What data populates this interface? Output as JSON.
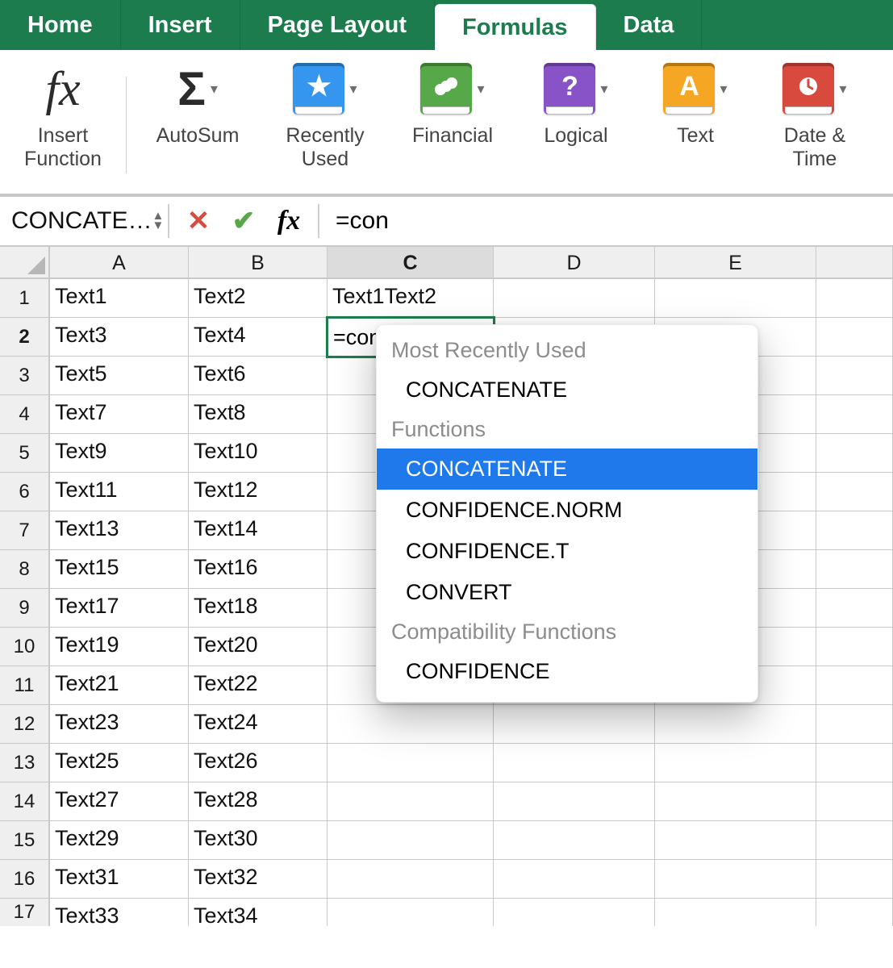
{
  "tabs": {
    "home": "Home",
    "insert": "Insert",
    "page_layout": "Page Layout",
    "formulas": "Formulas",
    "data": "Data"
  },
  "ribbon": {
    "insert_function": "Insert\nFunction",
    "autosum": "AutoSum",
    "recently_used": "Recently\nUsed",
    "financial": "Financial",
    "logical": "Logical",
    "text": "Text",
    "date_time": "Date &\nTime"
  },
  "namebox": "CONCATE…",
  "formula": "=con",
  "columns": [
    "A",
    "B",
    "C",
    "D",
    "E"
  ],
  "active": {
    "col": "C",
    "row": 2,
    "value": "=con"
  },
  "rows": [
    {
      "n": 1,
      "A": "Text1",
      "B": "Text2",
      "C": "Text1Text2"
    },
    {
      "n": 2,
      "A": "Text3",
      "B": "Text4",
      "C": "=con"
    },
    {
      "n": 3,
      "A": "Text5",
      "B": "Text6"
    },
    {
      "n": 4,
      "A": "Text7",
      "B": "Text8"
    },
    {
      "n": 5,
      "A": "Text9",
      "B": "Text10"
    },
    {
      "n": 6,
      "A": "Text11",
      "B": "Text12"
    },
    {
      "n": 7,
      "A": "Text13",
      "B": "Text14"
    },
    {
      "n": 8,
      "A": "Text15",
      "B": "Text16"
    },
    {
      "n": 9,
      "A": "Text17",
      "B": "Text18"
    },
    {
      "n": 10,
      "A": "Text19",
      "B": "Text20"
    },
    {
      "n": 11,
      "A": "Text21",
      "B": "Text22"
    },
    {
      "n": 12,
      "A": "Text23",
      "B": "Text24"
    },
    {
      "n": 13,
      "A": "Text25",
      "B": "Text26"
    },
    {
      "n": 14,
      "A": "Text27",
      "B": "Text28"
    },
    {
      "n": 15,
      "A": "Text29",
      "B": "Text30"
    },
    {
      "n": 16,
      "A": "Text31",
      "B": "Text32"
    },
    {
      "n": 17,
      "A": "Text33",
      "B": "Text34"
    }
  ],
  "autocomplete": {
    "groups": [
      {
        "header": "Most Recently Used",
        "items": [
          {
            "label": "CONCATENATE",
            "selected": false
          }
        ]
      },
      {
        "header": "Functions",
        "items": [
          {
            "label": "CONCATENATE",
            "selected": true
          },
          {
            "label": "CONFIDENCE.NORM",
            "selected": false
          },
          {
            "label": "CONFIDENCE.T",
            "selected": false
          },
          {
            "label": "CONVERT",
            "selected": false
          }
        ]
      },
      {
        "header": "Compatibility Functions",
        "items": [
          {
            "label": "CONFIDENCE",
            "selected": false
          }
        ]
      }
    ]
  },
  "colors": {
    "ribbon_green": "#1d7c4e",
    "star_blue": "#3596f0",
    "financial_green": "#57a848",
    "logical_purple": "#8753c7",
    "text_amber": "#f5a623",
    "date_red": "#d84a3e"
  }
}
